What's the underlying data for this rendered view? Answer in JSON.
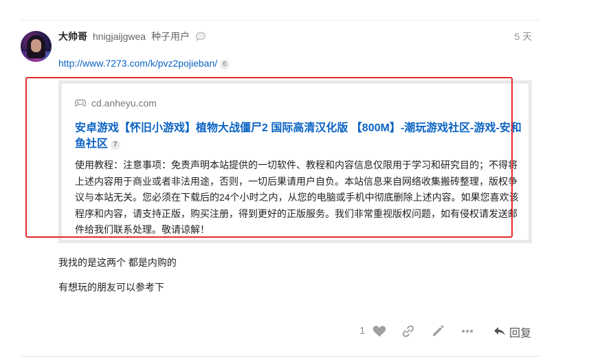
{
  "post": {
    "username": "大帅哥",
    "full_name": "hnigjaijgwea",
    "user_title": "种子用户",
    "date": "5 天",
    "link": {
      "text": "http://www.7273.com/k/pvz2pojieban/",
      "clicks": "6"
    },
    "onebox": {
      "source": "cd.anheyu.com",
      "title": "安卓游戏【怀旧小游戏】植物大战僵尸2 国际高清汉化版 【800M】-潮玩游戏社区-游戏-安和鱼社区",
      "title_clicks": "7",
      "description": "使用教程：注意事项：免责声明本站提供的一切软件、教程和内容信息仅限用于学习和研究目的；不得将上述内容用于商业或者非法用途，否则，一切后果请用户自负。本站信息来自网络收集搬砖整理，版权争议与本站无关。您必须在下载后的24个小时之内，从您的电脑或手机中彻底删除上述内容。如果您喜欢该程序和内容，请支持正版，购买注册，得到更好的正版服务。我们非常重视版权问题，如有侵权请发送邮件给我们联系处理。敬请谅解！"
    },
    "paragraphs": [
      "我找的是这两个 都是内购的",
      "有想玩的朋友可以参考下"
    ],
    "actions": {
      "like_count": "1",
      "reply_label": "回复"
    }
  },
  "colors": {
    "link": "#0b63c4",
    "highlight_border": "#e52828",
    "muted": "#919191"
  },
  "icons": [
    "chat-bubble-icon",
    "gamepad-icon",
    "heart-icon",
    "link-icon",
    "pencil-icon",
    "more-icon",
    "reply-icon"
  ]
}
